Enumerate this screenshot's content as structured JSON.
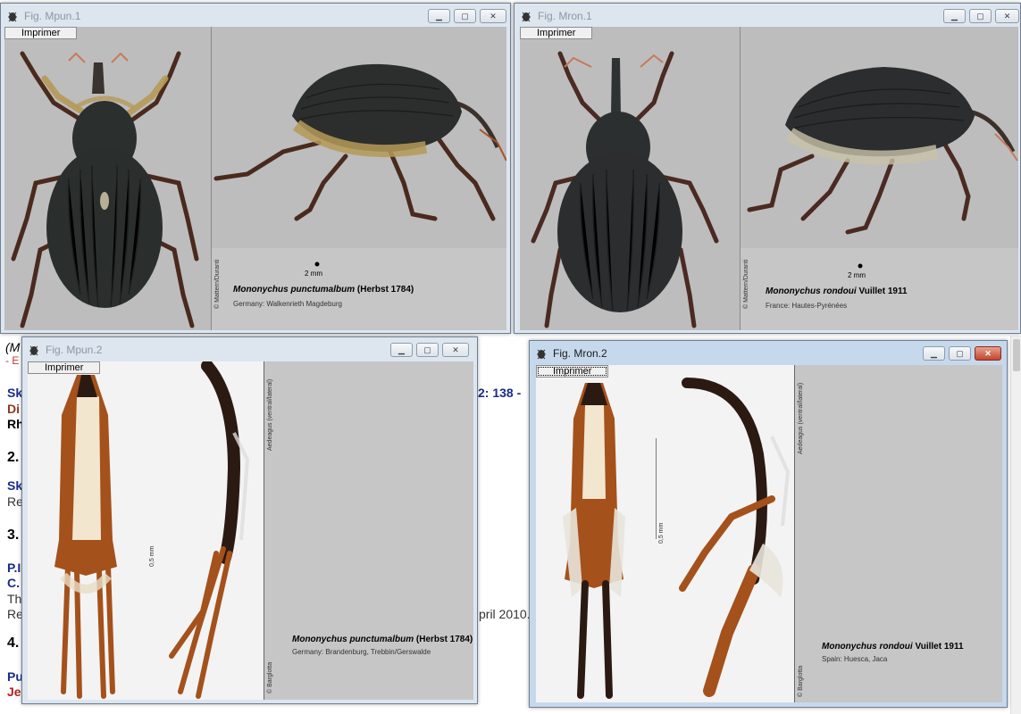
{
  "background": {
    "lines": [
      {
        "text": "(M",
        "color": "#000000"
      },
      {
        "text": "- E",
        "color": "#c0392b"
      },
      {
        "text": "Sk",
        "color": "#1a2c8a"
      },
      {
        "text": "Di",
        "color": "#8b3a1e"
      },
      {
        "text": "Rh",
        "color": "#000000"
      },
      {
        "text": "2.",
        "color": "#000000"
      },
      {
        "text": "Sk",
        "color": "#1a2c8a"
      },
      {
        "text": "Re",
        "color": "#333333"
      },
      {
        "text": "3.",
        "color": "#000000"
      },
      {
        "text": "P.I",
        "color": "#1a2c8a"
      },
      {
        "text": "C.",
        "color": "#1a2c8a"
      },
      {
        "text": "Th",
        "color": "#333333"
      },
      {
        "text": "Re",
        "color": "#333333"
      },
      {
        "text": "4.",
        "color": "#000000"
      },
      {
        "text": "Pu",
        "color": "#1a2c8a"
      },
      {
        "text": "Je",
        "color": "#b02020"
      },
      {
        "text": "2: 138 -",
        "color": "#1a2c8a"
      },
      {
        "text": "pril 2010.",
        "color": "#333333"
      }
    ]
  },
  "windows": [
    {
      "title": "Fig. Mpun.1",
      "print_label": "Imprimer",
      "scale_label": "2 mm",
      "species_name": "Mononychus punctumalbum",
      "species_author": "(Herbst 1784)",
      "locality": "Germany: Walkenrieth Magdeburg",
      "credit": "© Mattern/Duranti",
      "colors": {
        "body": "#2a2e2c",
        "hair": "#b59a58",
        "legs": "#4a2a1e"
      }
    },
    {
      "title": "Fig. Mron.1",
      "print_label": "Imprimer",
      "scale_label": "2 mm",
      "species_name": "Mononychus rondoui",
      "species_author": "Vuillet 1911",
      "locality": "France: Hautes-Pyrénées",
      "credit": "© Mattern/Duranti",
      "colors": {
        "body": "#2b2d2e",
        "hair": "#c8c2a8",
        "legs": "#4a2a22"
      }
    },
    {
      "title": "Fig. Mpun.2",
      "print_label": "Imprimer",
      "scale_label": "0,5 mm",
      "species_name": "Mononychus punctumalbum",
      "species_author": "(Herbst 1784)",
      "locality": "Germany: Brandenburg, Trebbin/Gerswalde",
      "credit": "Aedeagus (ventral/lateral)",
      "credit2": "© Barglotta",
      "colors": {
        "tube": "#a4511b",
        "dark": "#2b1a12",
        "pale": "#f3e6cf"
      }
    },
    {
      "title": "Fig. Mron.2",
      "print_label": "Imprimer",
      "scale_label": "0,5 mm",
      "species_name": "Mononychus rondoui",
      "species_author": "Vuillet 1911",
      "locality": "Spain: Huesca, Jaca",
      "credit": "Aedeagus (ventral/lateral)",
      "credit2": "© Barglotta",
      "colors": {
        "tube": "#a4511b",
        "dark": "#2b1a12",
        "pale": "#f3e6cf"
      }
    }
  ],
  "window_buttons": {
    "minimize": "▁",
    "maximize": "▢",
    "close": "✕"
  }
}
